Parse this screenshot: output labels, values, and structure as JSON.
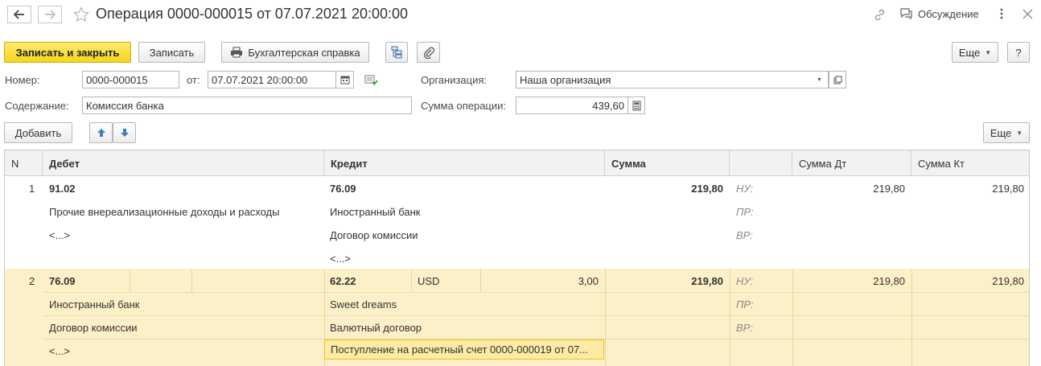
{
  "window": {
    "title": "Операция 0000-000015 от 07.07.2021 20:00:00",
    "discuss_label": "Обсуждение"
  },
  "toolbar": {
    "save_close_label": "Записать и закрыть",
    "save_label": "Записать",
    "report_label": "Бухгалтерская справка",
    "more_label": "Еще",
    "help_label": "?"
  },
  "form": {
    "number_label": "Номер:",
    "number_value": "0000-000015",
    "date_label": "от:",
    "date_value": "07.07.2021 20:00:00",
    "org_label": "Организация:",
    "org_value": "Наша организация",
    "content_label": "Содержание:",
    "content_value": "Комиссия банка",
    "sum_label": "Сумма операции:",
    "sum_value": "439,60"
  },
  "table_toolbar": {
    "add_label": "Добавить",
    "more_label": "Еще"
  },
  "table": {
    "columns": [
      "N",
      "Дебет",
      "Кредит",
      "Сумма",
      "Сумма Дт",
      "Сумма Кт"
    ],
    "rows": [
      {
        "n": "1",
        "debit_account": "91.02",
        "debit_sub1": "Прочие внереализационные доходы и расходы",
        "debit_sub2": "<...>",
        "credit_account": "76.09",
        "credit_sub1": "Иностранный банк",
        "credit_sub2": "Договор комиссии",
        "credit_sub3": "<...>",
        "sum": "219,80",
        "nu_label": "НУ:",
        "pr_label": "ПР:",
        "vr_label": "ВР:",
        "sum_dt": "219,80",
        "sum_kt": "219,80"
      },
      {
        "n": "2",
        "debit_account": "76.09",
        "debit_sub1": "Иностранный банк",
        "debit_sub2": "Договор комиссии",
        "debit_sub3": "<...>",
        "credit_account": "62.22",
        "credit_currency": "USD",
        "credit_amount": "3,00",
        "credit_sub1": "Sweet dreams",
        "credit_sub2": "Валютный договор",
        "credit_sub3": "Поступление на расчетный счет 0000-000019 от 07...",
        "sum": "219,80",
        "nu_label": "НУ:",
        "pr_label": "ПР:",
        "vr_label": "ВР:",
        "sum_dt": "219,80",
        "sum_kt": "219,80"
      }
    ]
  }
}
